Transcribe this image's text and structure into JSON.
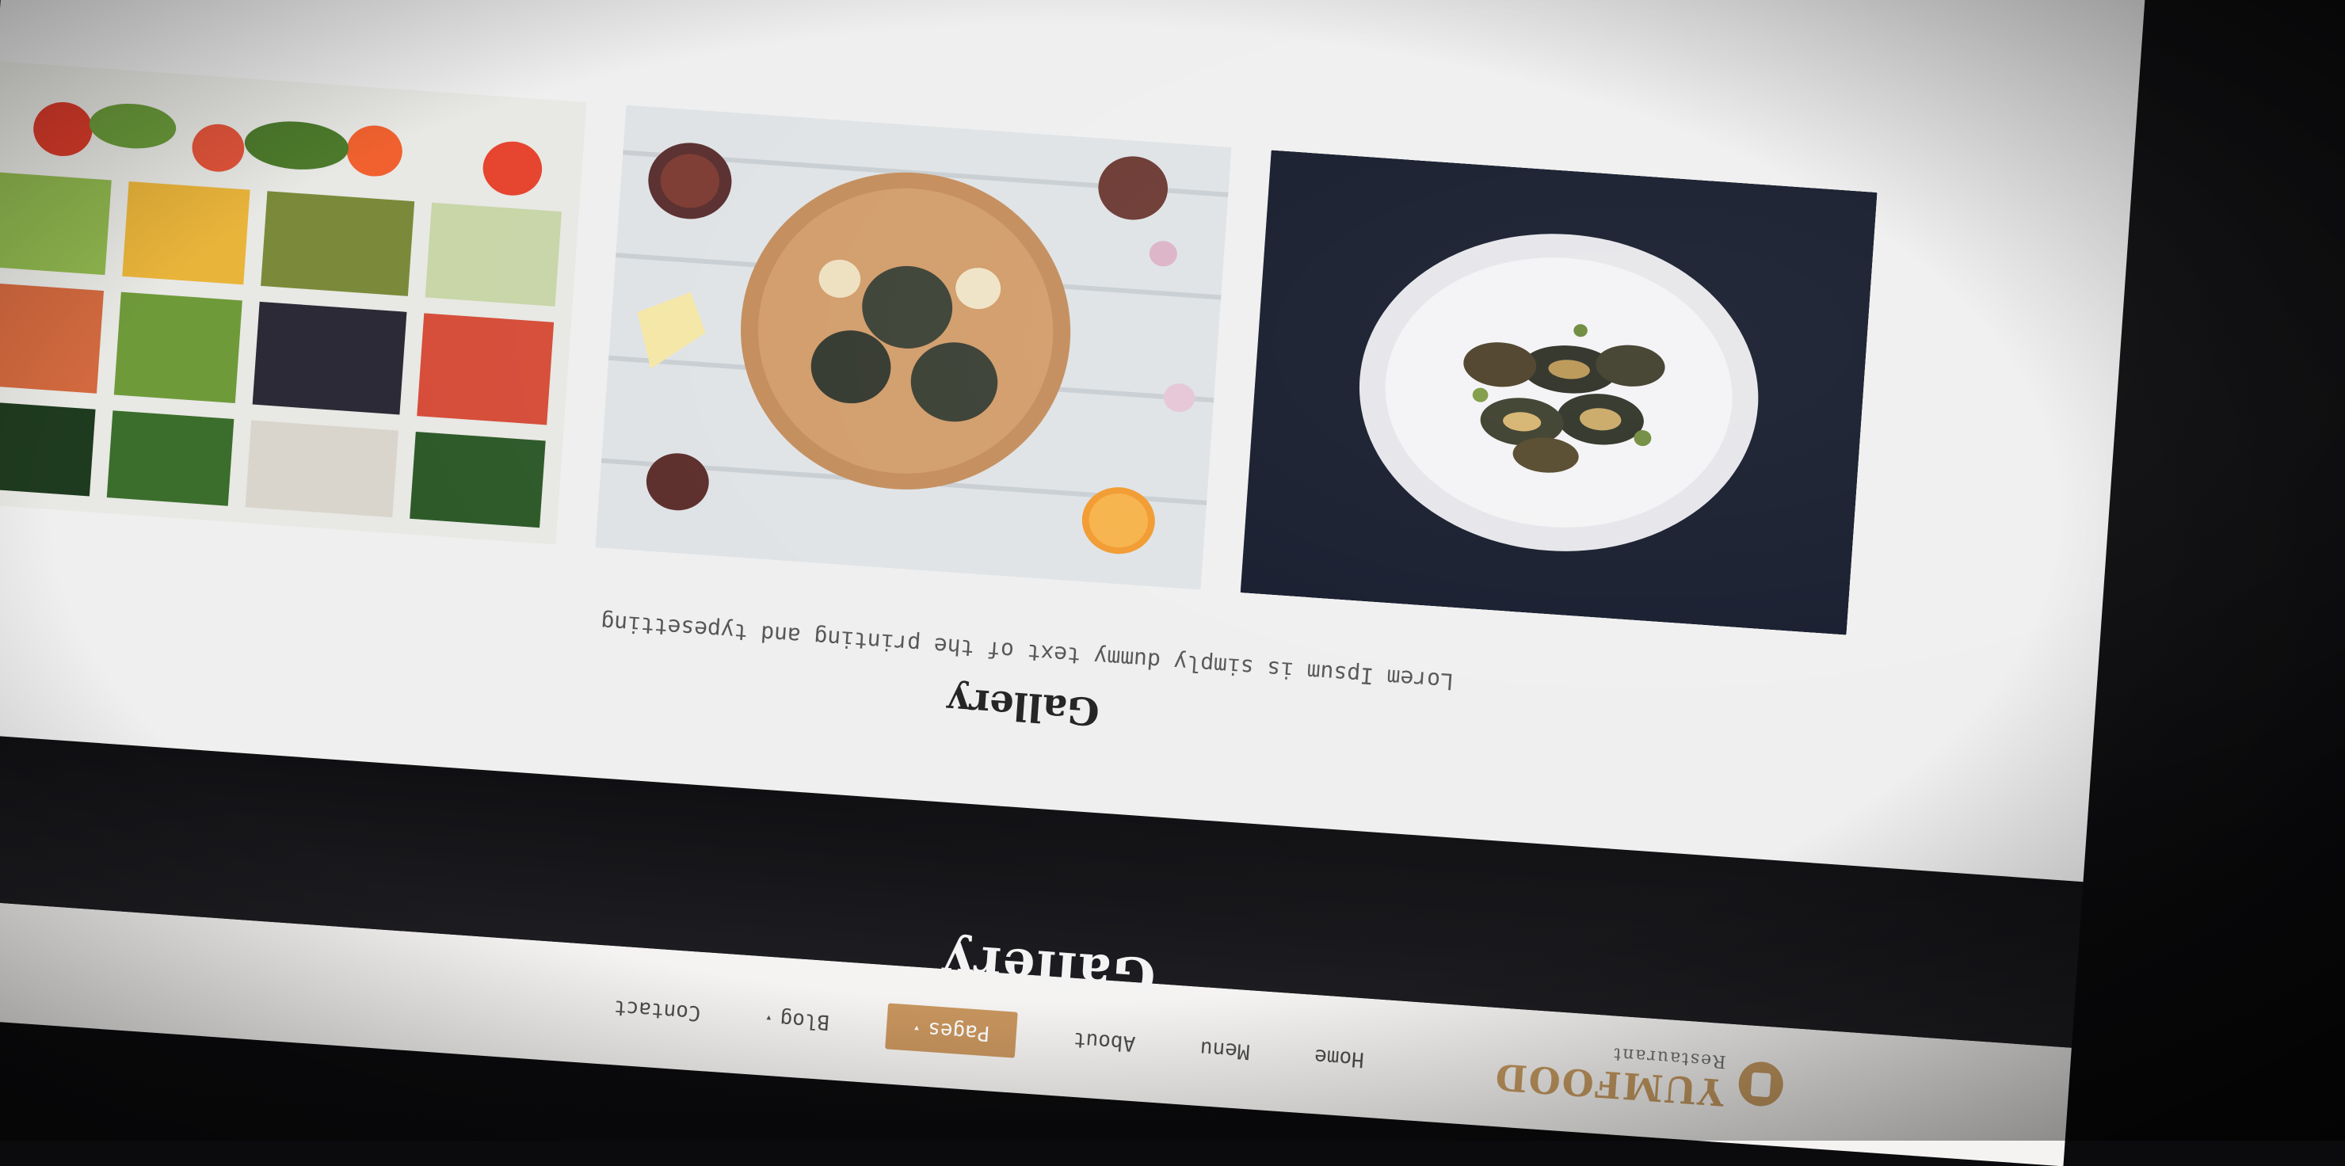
{
  "brand": {
    "name": "YUMFOOD",
    "subtitle": "Restaurant"
  },
  "nav": {
    "items": [
      {
        "label": "Home"
      },
      {
        "label": "Menu"
      },
      {
        "label": "About"
      },
      {
        "label": "Pages",
        "active": true,
        "caret": "▾"
      },
      {
        "label": "Blog",
        "caret": "▾"
      },
      {
        "label": "Contact"
      }
    ]
  },
  "hero": {
    "title": "Gallery"
  },
  "gallery": {
    "title": "Gallery",
    "subtitle": "Lorem Ipsum is simply dummy text of the printing and typesetting",
    "tiles": [
      {
        "name": "mussels-plate-image"
      },
      {
        "name": "tart-on-board-image"
      },
      {
        "name": "vegetable-market-image"
      }
    ]
  },
  "colors": {
    "accent": "#c8955e",
    "nav_bg": "#f4f3f1",
    "gallery_bg": "#efefef",
    "hero_bg": "#1d1d21"
  }
}
